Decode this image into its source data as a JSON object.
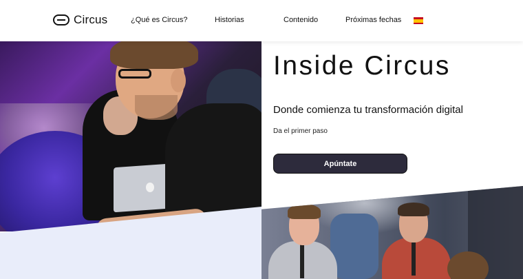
{
  "header": {
    "logo_text": "Circus",
    "nav": [
      {
        "label": "¿Qué es Circus?"
      },
      {
        "label": "Historias"
      },
      {
        "label": "Contenido"
      },
      {
        "label": "Próximas fechas"
      }
    ],
    "language_flag_icon": "spain-flag-icon"
  },
  "hero": {
    "title": "Inside Circus",
    "subtitle": "Donde comienza tu transformación digital",
    "step_text": "Da el primer paso",
    "cta_label": "Apúntate"
  },
  "colors": {
    "cta_background": "#2d2b3c",
    "lower_panel": "#e9edfa",
    "text": "#111111"
  }
}
